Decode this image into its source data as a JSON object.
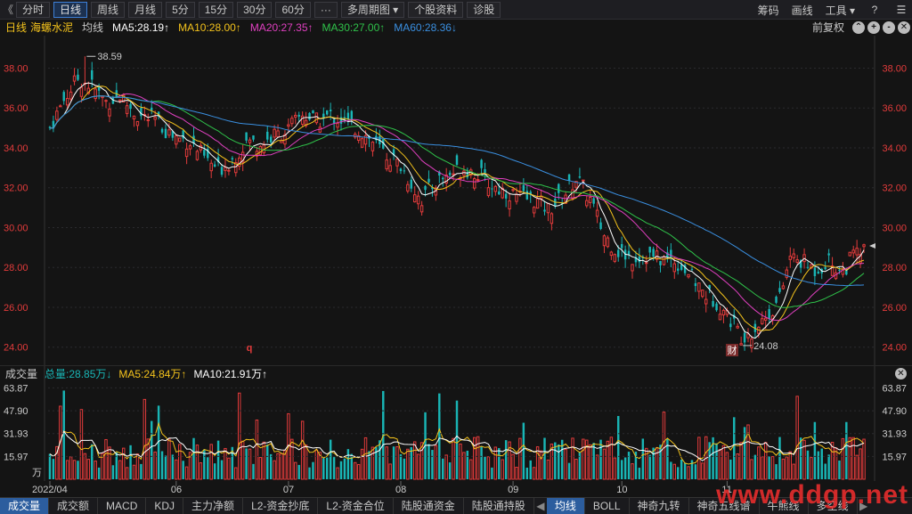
{
  "toolbar": {
    "back": "《",
    "buttons": [
      "分时",
      "日线",
      "周线",
      "月线",
      "5分",
      "15分",
      "30分",
      "60分",
      "···",
      "多周期图 ▾",
      "个股资料",
      "诊股"
    ],
    "active_index": 1,
    "right_items": [
      "筹码",
      "画线",
      "工具 ▾"
    ],
    "right_icons": [
      "?",
      "☰"
    ]
  },
  "ma_bar": {
    "period_label": "日线",
    "stock_name": "海螺水泥",
    "avg_label": "均线",
    "ma5": "MA5:28.19↑",
    "ma10": "MA10:28.00↑",
    "ma20": "MA20:27.35↑",
    "ma30": "MA30:27.00↑",
    "ma60": "MA60:28.36↓",
    "adjust": "前复权",
    "right_icons": [
      "⌃",
      "+",
      "-",
      "✕"
    ]
  },
  "colors": {
    "up": "#e23b3b",
    "down": "#19b5b5",
    "ma5": "#ffffff",
    "ma10": "#f3c21c",
    "ma20": "#e040c0",
    "ma30": "#2fc24a",
    "ma60": "#3a8fe0",
    "accent": "#2c5d9e"
  },
  "price_axis": {
    "labels": [
      "38.00",
      "36.00",
      "34.00",
      "32.00",
      "30.00",
      "28.00",
      "26.00",
      "24.00"
    ],
    "values": [
      38,
      36,
      34,
      32,
      30,
      28,
      26,
      24
    ],
    "range": [
      23.45,
      39.45
    ],
    "high_label": "38.59",
    "low_label": "24.08",
    "marker_q": "q",
    "marker_cai": "财"
  },
  "volume_bar": {
    "title": "成交量",
    "total": "总量:28.85万↓",
    "ma5": "MA5:24.84万↑",
    "ma10": "MA10:21.91万↑",
    "close_icon": "✕"
  },
  "volume_axis": {
    "labels": [
      "63.87",
      "47.90",
      "31.93",
      "15.97"
    ],
    "values": [
      63.87,
      47.9,
      31.93,
      15.97
    ],
    "unit": "万",
    "max": 66
  },
  "date_axis": [
    "2022/04",
    "06",
    "07",
    "08",
    "09",
    "10",
    "11"
  ],
  "tabs": [
    "成交量",
    "成交额",
    "MACD",
    "KDJ",
    "主力净额",
    "L2-资金抄底",
    "L2-资金合位",
    "陆股通资金",
    "陆股通持股"
  ],
  "tabs_right": [
    "均线",
    "BOLL",
    "神奇九转",
    "神奇五线谱",
    "牛熊线",
    "多空线"
  ],
  "tab_arrows": [
    "◀",
    "▶"
  ],
  "watermark": "www.ddgp.net",
  "chart_data": {
    "type": "candlestick",
    "title": "海螺水泥",
    "ylim": [
      23.45,
      39.45
    ],
    "date_ticks": [
      "2022/04",
      "06",
      "07",
      "08",
      "09",
      "10",
      "11"
    ],
    "price_anchors": [
      [
        0,
        35.0
      ],
      [
        4,
        36.4
      ],
      [
        8,
        37.5
      ],
      [
        12,
        37.1
      ],
      [
        16,
        36.3
      ],
      [
        20,
        36.6
      ],
      [
        25,
        35.6
      ],
      [
        30,
        35.4
      ],
      [
        35,
        34.6
      ],
      [
        40,
        34.3
      ],
      [
        45,
        33.3
      ],
      [
        48,
        32.9
      ],
      [
        52,
        33.4
      ],
      [
        56,
        34.3
      ],
      [
        60,
        34.2
      ],
      [
        64,
        34.6
      ],
      [
        68,
        34.9
      ],
      [
        72,
        35.7
      ],
      [
        76,
        35.3
      ],
      [
        80,
        35.6
      ],
      [
        84,
        35.3
      ],
      [
        88,
        34.9
      ],
      [
        92,
        34.3
      ],
      [
        96,
        33.6
      ],
      [
        100,
        33.1
      ],
      [
        104,
        31.9
      ],
      [
        106,
        31.4
      ],
      [
        110,
        32.3
      ],
      [
        114,
        32.7
      ],
      [
        118,
        33.0
      ],
      [
        122,
        32.7
      ],
      [
        126,
        32.1
      ],
      [
        130,
        31.8
      ],
      [
        134,
        31.5
      ],
      [
        138,
        31.4
      ],
      [
        142,
        30.9
      ],
      [
        146,
        31.5
      ],
      [
        150,
        32.5
      ],
      [
        154,
        31.4
      ],
      [
        158,
        29.6
      ],
      [
        162,
        28.8
      ],
      [
        166,
        28.5
      ],
      [
        170,
        28.6
      ],
      [
        174,
        28.4
      ],
      [
        178,
        28.4
      ],
      [
        182,
        27.7
      ],
      [
        186,
        26.8
      ],
      [
        190,
        26.3
      ],
      [
        194,
        25.4
      ],
      [
        197,
        24.6
      ],
      [
        200,
        24.8
      ],
      [
        204,
        25.5
      ],
      [
        208,
        26.4
      ],
      [
        211,
        28.5
      ],
      [
        214,
        28.3
      ],
      [
        218,
        27.9
      ],
      [
        222,
        28.3
      ],
      [
        226,
        27.8
      ],
      [
        229,
        28.6
      ],
      [
        232,
        28.8
      ]
    ],
    "candle_count": 233,
    "volume_ma_legend": [
      "MA5",
      "MA10"
    ]
  }
}
